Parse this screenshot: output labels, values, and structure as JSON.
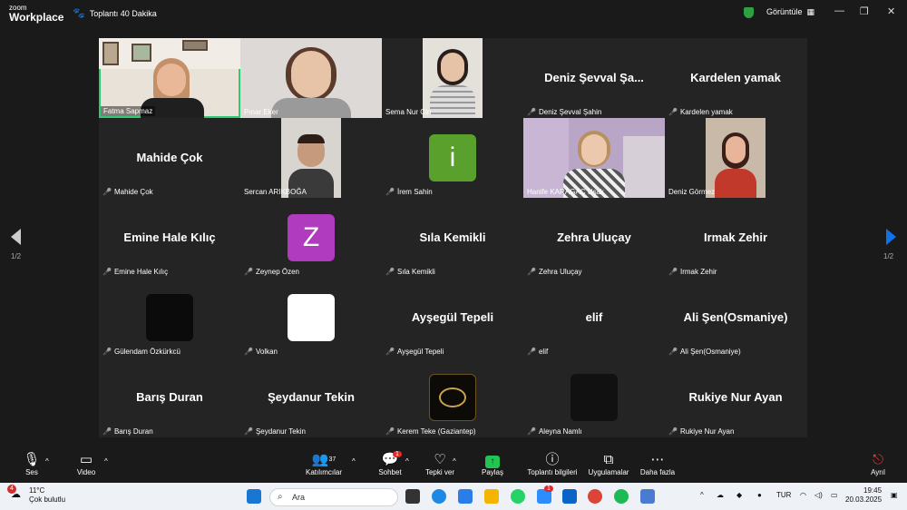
{
  "window": {
    "logo_line1": "zoom",
    "logo_line2": "Workplace",
    "meeting_title": "Toplantı 40 Dakika",
    "view_label": "Görüntüle"
  },
  "pagination": {
    "left": "1/2",
    "right": "1/2"
  },
  "tiles": [
    {
      "label": "Fatma Sapmaz"
    },
    {
      "label": "Pınar Eker"
    },
    {
      "label": "Sema Nur Cin"
    },
    {
      "label": "Deniz Şevval Şahin",
      "big": "Deniz Şevval Şa..."
    },
    {
      "label": "Kardelen yamak",
      "big": "Kardelen yamak"
    },
    {
      "label": "Mahide Çok",
      "big": "Mahide Çok"
    },
    {
      "label": "Sercan ARIKBOĞA"
    },
    {
      "label": "İrem Sahin",
      "avatar": "i"
    },
    {
      "label": "Hanife KARAGAÇ Uşak"
    },
    {
      "label": "Deniz Görmez"
    },
    {
      "label": "Emine Hale Kılıç",
      "big": "Emine Hale Kılıç"
    },
    {
      "label": "Zeynep Özen",
      "avatar": "Z"
    },
    {
      "label": "Sıla Kemikli",
      "big": "Sıla Kemikli"
    },
    {
      "label": "Zehra Uluçay",
      "big": "Zehra Uluçay"
    },
    {
      "label": "Irmak Zehir",
      "big": "Irmak Zehir"
    },
    {
      "label": "Gülendam Özkürkcü"
    },
    {
      "label": "Volkan"
    },
    {
      "label": "Ayşegül Tepeli",
      "big": "Ayşegül Tepeli"
    },
    {
      "label": "elif",
      "big": "elif"
    },
    {
      "label": "Ali Şen(Osmaniye)",
      "big": "Ali Şen(Osmaniye)"
    },
    {
      "label": "Barış Duran",
      "big": "Barış Duran"
    },
    {
      "label": "Şeydanur Tekin",
      "big": "Şeydanur Tekin"
    },
    {
      "label": "Kerem Teke (Gaziantep)"
    },
    {
      "label": "Aleyna Namlı"
    },
    {
      "label": "Rukiye Nur Ayan",
      "big": "Rukiye Nur Ayan"
    }
  ],
  "toolbar": {
    "audio": "Ses",
    "video": "Video",
    "participants": "Katılımcılar",
    "participants_count": "37",
    "chat": "Sohbet",
    "chat_badge": "1",
    "reactions": "Tepki ver",
    "share": "Paylaş",
    "info": "Toplantı bilgileri",
    "apps": "Uygulamalar",
    "more": "Daha fazla",
    "leave": "Ayrıl"
  },
  "taskbar": {
    "weather_temp": "11°C",
    "weather_desc": "Çok bulutlu",
    "weather_badge": "4",
    "search_placeholder": "Ara",
    "lang": "TUR",
    "time": "19:45",
    "date": "20.03.2025",
    "app_badge": "1"
  },
  "colors": {
    "active_speaker": "#2ecc71",
    "muted_mic": "#e03b3b",
    "share_green": "#23c552",
    "avatar_i": "#5aa02c",
    "avatar_z": "#b03bbf",
    "next_arrow": "#0e72ed"
  }
}
